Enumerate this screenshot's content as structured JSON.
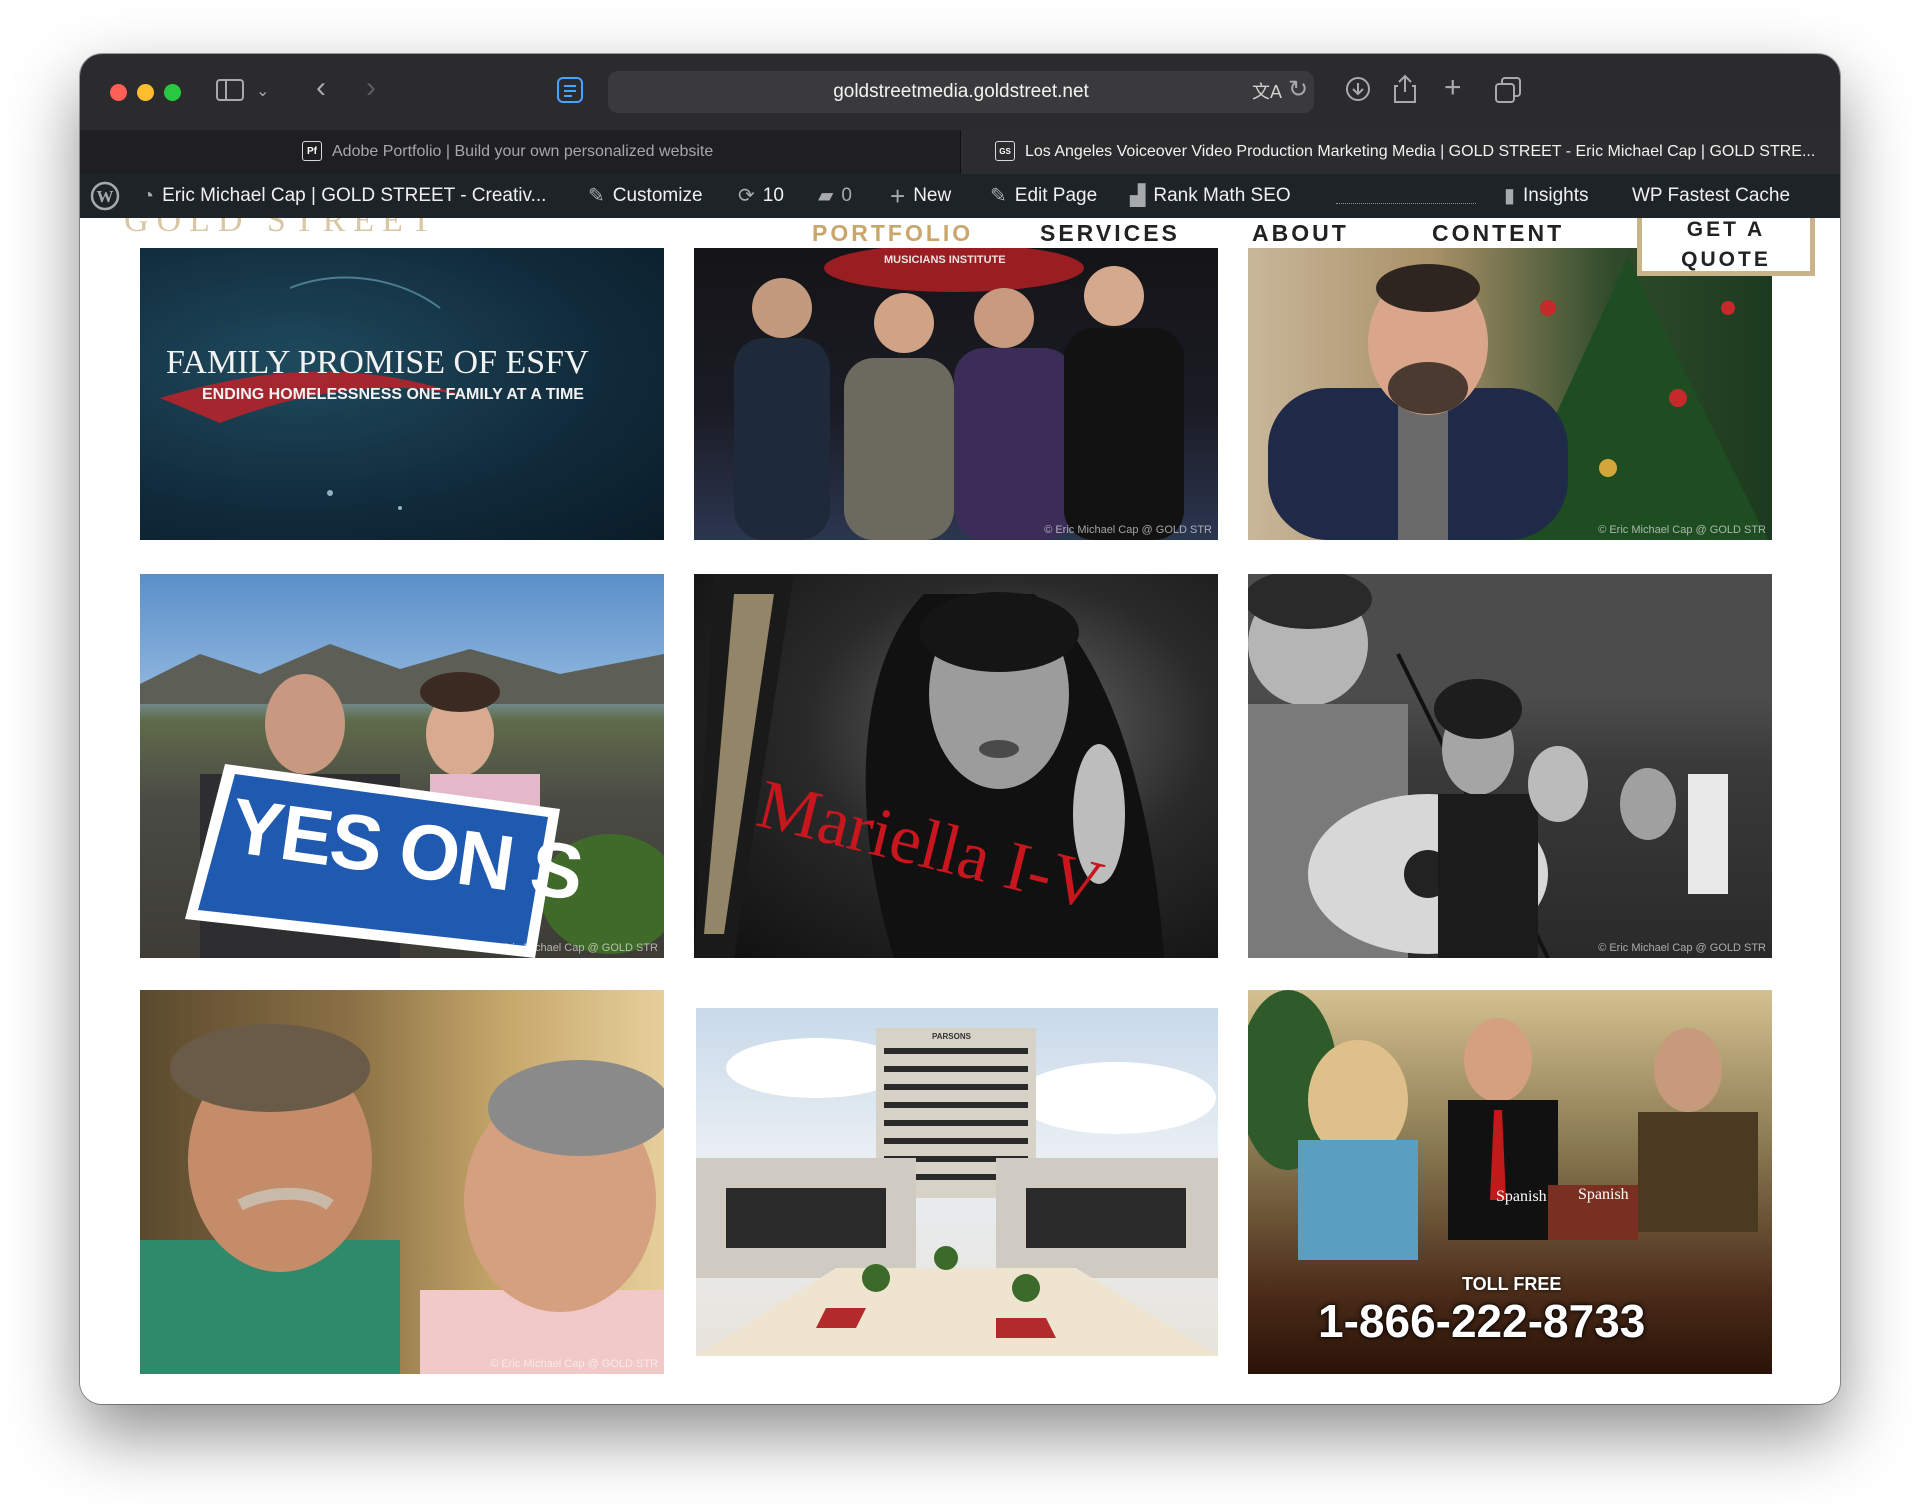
{
  "browser": {
    "url": "goldstreetmedia.goldstreet.net",
    "tabs": [
      {
        "icon_text": "Pf",
        "label": "Adobe Portfolio | Build your own personalized website",
        "active": false
      },
      {
        "icon_text": "GS",
        "label": "Los Angeles Voiceover Video Production Marketing Media | GOLD STREET - Eric Michael Cap | GOLD STRE...",
        "active": true
      }
    ]
  },
  "admin_bar": {
    "site_name": "Eric Michael Cap | GOLD STREET - Creativ...",
    "customize": "Customize",
    "updates_count": "10",
    "comments_count": "0",
    "new": "New",
    "edit_page": "Edit Page",
    "rank_math": "Rank Math SEO",
    "insights": "Insights",
    "wp_fastest_cache": "WP Fastest Cache"
  },
  "site": {
    "logo": "GOLD STREET",
    "nav": [
      "PORTFOLIO",
      "SERVICES",
      "ABOUT",
      "CONTENT"
    ],
    "active_nav": "PORTFOLIO",
    "quote_line1": "GET A",
    "quote_line2": "QUOTE",
    "accent": "#c9a66b"
  },
  "portfolio": {
    "family_title": "FAMILY PROMISE OF ESFV",
    "family_subtitle": "ENDING HOMELESSNESS ONE FAMILY AT A TIME",
    "sign_text": "YES ON S",
    "mariella": "Mariella I-V",
    "toll_free": "TOLL FREE",
    "phone": "1-866-222-8733",
    "spanish_1": "Spanish",
    "spanish_2": "Spanish",
    "credit": "© Eric Michael Cap @ GOLD STR",
    "building_sign": "PARSONS",
    "banner_text": "MUSICIANS INSTITUTE"
  }
}
